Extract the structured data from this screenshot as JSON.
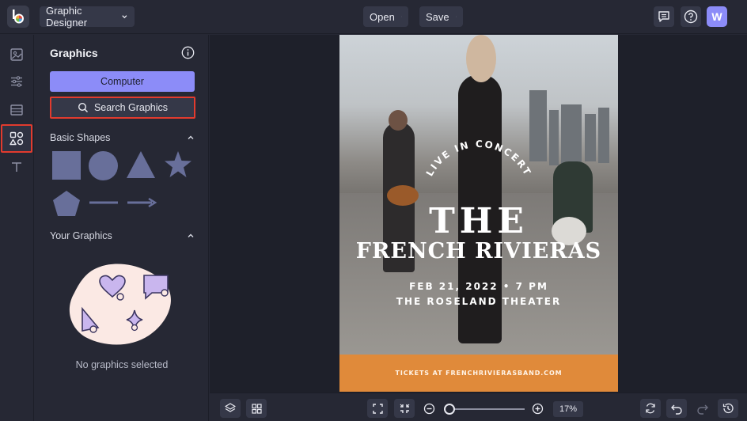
{
  "header": {
    "app_name": "Graphic Designer",
    "open_label": "Open",
    "save_label": "Save",
    "avatar_initial": "W"
  },
  "rail": {
    "items": [
      "image-icon",
      "adjust-icon",
      "layout-icon",
      "graphics-icon",
      "text-icon"
    ],
    "active": "graphics-icon"
  },
  "panel": {
    "title": "Graphics",
    "computer_label": "Computer",
    "search_label": "Search Graphics",
    "basic_shapes_title": "Basic Shapes",
    "your_graphics_title": "Your Graphics",
    "empty_text": "No graphics selected"
  },
  "poster": {
    "arc_text": "LIVE IN CONCERT",
    "title_line1": "THE",
    "title_line2": "FRENCH RIVIERAS",
    "date": "FEB 21, 2022 • 7 PM",
    "venue": "THE ROSELAND THEATER",
    "tickets": "TICKETS AT FRENCHRIVIERASBAND.COM",
    "band_color": "#e08a3a"
  },
  "footer": {
    "zoom": "17%"
  },
  "colors": {
    "accent": "#8c8cf8",
    "highlight": "#e23b2e",
    "shape": "#686f9a"
  }
}
